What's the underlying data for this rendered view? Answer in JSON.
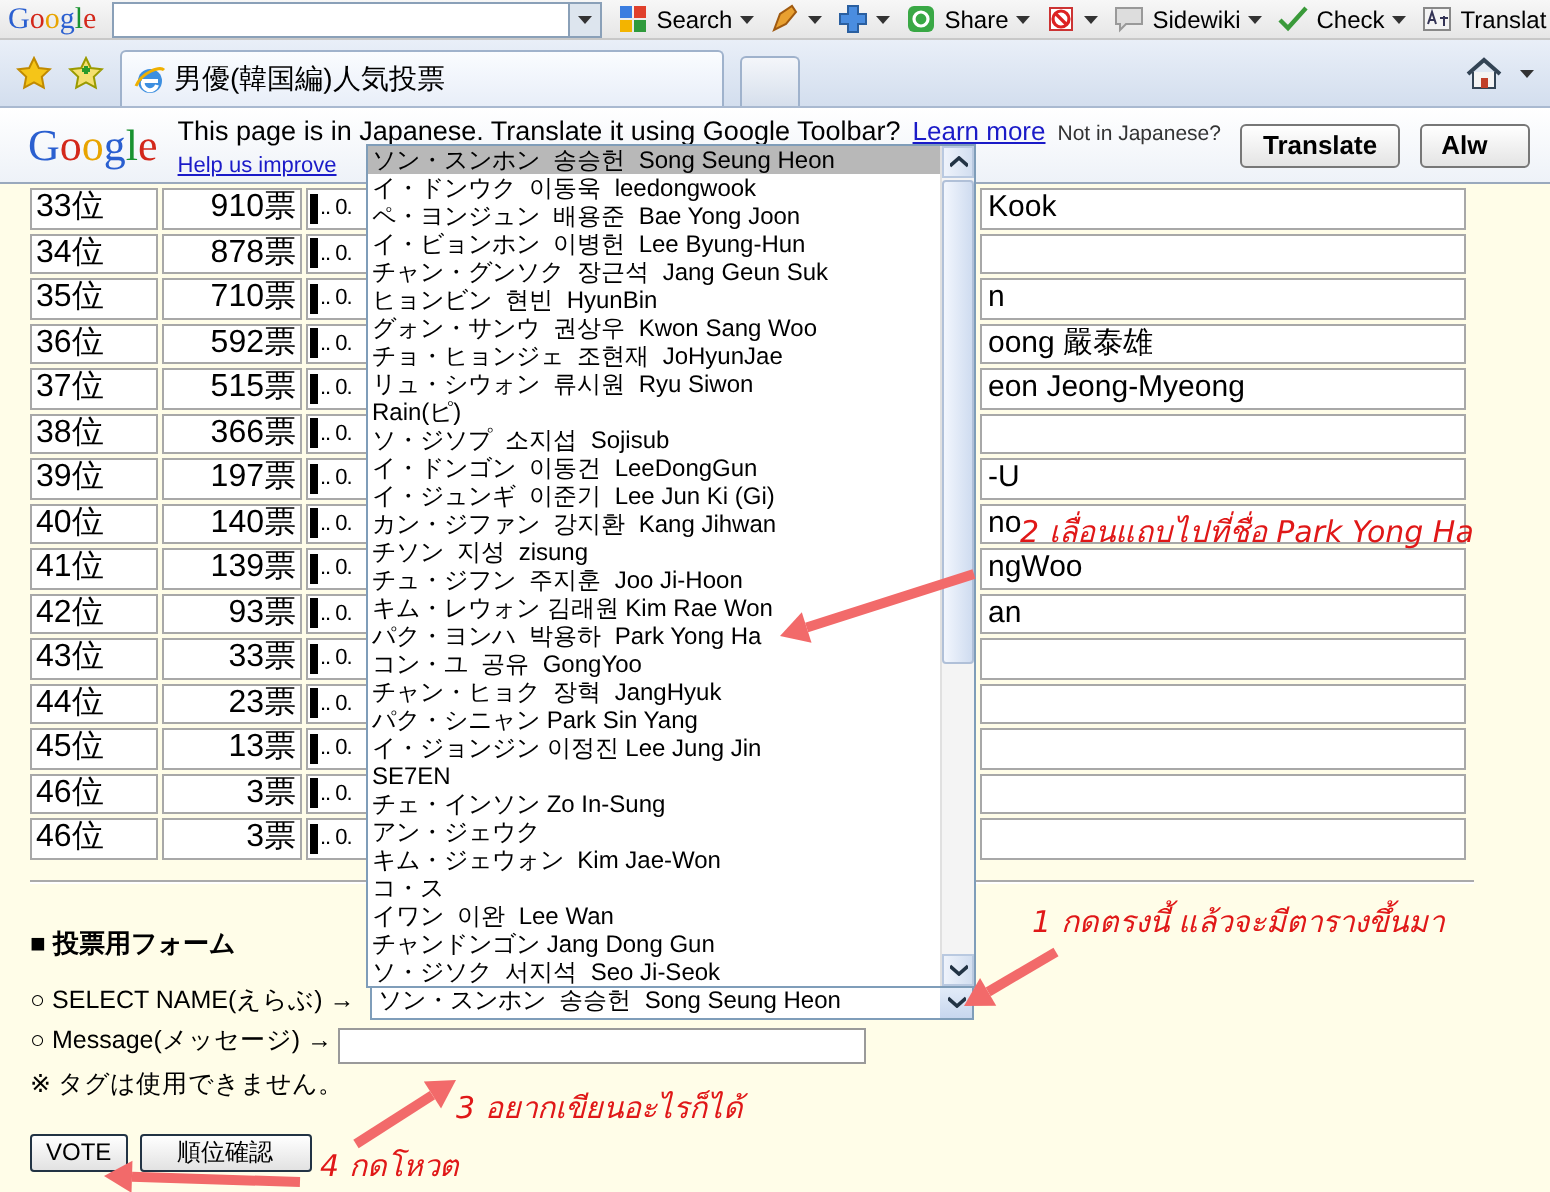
{
  "toolbar": {
    "logo": "Google",
    "buttons": [
      {
        "kind": "search",
        "label": "Search"
      },
      {
        "kind": "bookmark"
      },
      {
        "kind": "plus"
      },
      {
        "kind": "share",
        "label": "Share"
      },
      {
        "kind": "block"
      },
      {
        "kind": "sidewiki",
        "label": "Sidewiki"
      },
      {
        "kind": "check",
        "label": "Check"
      },
      {
        "kind": "translate",
        "label": "Translat"
      }
    ]
  },
  "tabs": [
    {
      "title": "男優(韓国編)人気投票",
      "selected": true
    }
  ],
  "translate_bar": {
    "logo": "Google",
    "message": "This page is in Japanese. Translate it using Google Toolbar?",
    "help_link": "Help us improve",
    "learn_more": "Learn more",
    "not_language": "Not in Japanese?",
    "buttons": [
      "Translate",
      "Alw"
    ]
  },
  "ranking": {
    "rows": [
      {
        "rank": "33位",
        "votes": "910票",
        "level": 0.02,
        "share": ".. 0.",
        "name": "Kook"
      },
      {
        "rank": "34位",
        "votes": "878票",
        "level": 0.02,
        "share": ".. 0.",
        "name": ""
      },
      {
        "rank": "35位",
        "votes": "710票",
        "level": 0.02,
        "share": ".. 0.",
        "name": "n"
      },
      {
        "rank": "36位",
        "votes": "592票",
        "level": 0.02,
        "share": ".. 0.",
        "name": "oong 嚴泰雄"
      },
      {
        "rank": "37位",
        "votes": "515票",
        "level": 0.02,
        "share": ".. 0.",
        "name": "eon Jeong-Myeong"
      },
      {
        "rank": "38位",
        "votes": "366票",
        "level": 0.02,
        "share": ".. 0.",
        "name": ""
      },
      {
        "rank": "39位",
        "votes": "197票",
        "level": 0.02,
        "share": ".. 0.",
        "name": "-U"
      },
      {
        "rank": "40位",
        "votes": "140票",
        "level": 0.02,
        "share": ".. 0.",
        "name": "no"
      },
      {
        "rank": "41位",
        "votes": "139票",
        "level": 0.02,
        "share": ".. 0.",
        "name": "ngWoo"
      },
      {
        "rank": "42位",
        "votes": "93票",
        "level": 0.02,
        "share": ".. 0.",
        "name": "an"
      },
      {
        "rank": "43位",
        "votes": "33票",
        "level": 0.02,
        "share": ".. 0.",
        "name": ""
      },
      {
        "rank": "44位",
        "votes": "23票",
        "level": 0.02,
        "share": ".. 0.",
        "name": ""
      },
      {
        "rank": "45位",
        "votes": "13票",
        "level": 0.02,
        "share": ".. 0.",
        "name": ""
      },
      {
        "rank": "46位",
        "votes": "3票",
        "level": 0.02,
        "share": ".. 0.",
        "name": ""
      },
      {
        "rank": "46位",
        "votes": "3票",
        "level": 0.02,
        "share": ".. 0.",
        "name": ""
      }
    ]
  },
  "form": {
    "heading": "■ 投票用フォーム",
    "name_label": "○ SELECT NAME(えらぶ) →",
    "name_value": "ソン・スンホン  송승헌  Song Seung Heon",
    "message_label": "○ Message(メッセージ) →",
    "note": "※ タグは使用できません。",
    "buttons": [
      "VOTE",
      "順位確認"
    ]
  },
  "dropdown_list": {
    "items": [
      {
        "label": "ソン・スンホン  송승헌  Song Seung Heon",
        "selected": true
      },
      {
        "label": "イ・ドンウク  이동욱  leedongwook",
        "selected": false
      },
      {
        "label": "ペ・ヨンジュン  배용준  Bae Yong Joon",
        "selected": false
      },
      {
        "label": "イ・ビョンホン  이병헌  Lee Byung-Hun",
        "selected": false
      },
      {
        "label": "チャン・グンソク  장근석  Jang Geun Suk",
        "selected": false
      },
      {
        "label": "ヒョンビン  현빈  HyunBin",
        "selected": false
      },
      {
        "label": "グォン・サンウ  권상우  Kwon Sang Woo",
        "selected": false
      },
      {
        "label": "チョ・ヒョンジェ  조현재  JoHyunJae",
        "selected": false
      },
      {
        "label": "リュ・シウォン  류시원  Ryu Siwon",
        "selected": false
      },
      {
        "label": "Rain(ピ)",
        "selected": false
      },
      {
        "label": "ソ・ジソプ  소지섭  Sojisub",
        "selected": false
      },
      {
        "label": "イ・ドンゴン  이동건  LeeDongGun",
        "selected": false
      },
      {
        "label": "イ・ジュンギ  이준기  Lee Jun Ki (Gi)",
        "selected": false
      },
      {
        "label": "カン・ジファン  강지환  Kang Jihwan",
        "selected": false
      },
      {
        "label": "チソン  지성  zisung",
        "selected": false
      },
      {
        "label": "チュ・ジフン  주지훈  Joo Ji-Hoon",
        "selected": false
      },
      {
        "label": "キム・レウォン 김래원 Kim Rae Won",
        "selected": false
      },
      {
        "label": "パク・ヨンハ  박용하  Park Yong Ha",
        "selected": false
      },
      {
        "label": "コン・ユ  공유  GongYoo",
        "selected": false
      },
      {
        "label": "チャン・ヒョク  장혁  JangHyuk",
        "selected": false
      },
      {
        "label": "パク・シニャン Park Sin Yang",
        "selected": false
      },
      {
        "label": "イ・ジョンジン 이정진 Lee Jung Jin",
        "selected": false
      },
      {
        "label": "SE7EN",
        "selected": false
      },
      {
        "label": "チェ・インソン Zo In-Sung",
        "selected": false
      },
      {
        "label": "アン・ジェウク",
        "selected": false
      },
      {
        "label": "キム・ジェウォン  Kim Jae-Won",
        "selected": false
      },
      {
        "label": "コ・ス",
        "selected": false
      },
      {
        "label": "イワン  이완  Lee Wan",
        "selected": false
      },
      {
        "label": "チャンドンゴン Jang Dong Gun",
        "selected": false
      },
      {
        "label": "ソ・ジソク  서지석  Seo Ji-Seok",
        "selected": false
      }
    ]
  },
  "annotations": [
    {
      "text": "2 เลื่อนแถบไปที่ชื่อ Park Yong Ha"
    },
    {
      "text": "1 กดตรงนี้ แล้วจะมีตารางขึ้นมา"
    },
    {
      "text": "3 อยากเขียนอะไรก็ได้"
    },
    {
      "text": "4 กดโหวต"
    }
  ]
}
